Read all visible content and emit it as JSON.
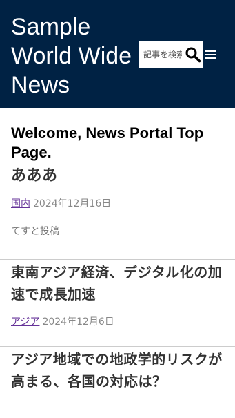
{
  "header": {
    "title_lines": [
      "Sample",
      "World Wide",
      "News"
    ],
    "search_placeholder": "記事を検索",
    "search_icon": "search-icon",
    "menu_icon": "hamburger-menu-icon",
    "background_color": "#002244"
  },
  "welcome": "Welcome, News Portal Top Page.",
  "articles": [
    {
      "title": "あああ",
      "category": "国内",
      "date": "2024年12月16日",
      "excerpt": "てすと投稿"
    },
    {
      "title": "東南アジア経済、デジタル化の加速で成長加速",
      "category": "アジア",
      "date": "2024年12月6日"
    },
    {
      "title": "アジア地域での地政学的リスクが高まる、各国の対応は？"
    }
  ]
}
